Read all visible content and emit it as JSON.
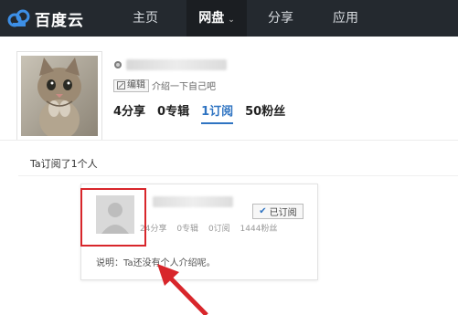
{
  "brand": {
    "name": "百度云"
  },
  "nav": {
    "items": [
      {
        "label": "主页"
      },
      {
        "label": "网盘"
      },
      {
        "label": "分享"
      },
      {
        "label": "应用"
      }
    ],
    "caret": "⌄"
  },
  "profile": {
    "edit_label": "编辑",
    "intro_text": "介绍一下自己吧",
    "stats": [
      {
        "label": "4分享"
      },
      {
        "label": "0专辑"
      },
      {
        "label": "1订阅"
      },
      {
        "label": "50粉丝"
      }
    ]
  },
  "section": {
    "title": "Ta订阅了1个人"
  },
  "subscription_card": {
    "stats": [
      "24分享",
      "0专辑",
      "0订阅",
      "1444粉丝"
    ],
    "button_label": "已订阅",
    "description": "说明：Ta还没有个人介绍呢。"
  },
  "colors": {
    "topbar": "#24292f",
    "accent": "#2f74c2",
    "highlight": "#d8262b"
  }
}
